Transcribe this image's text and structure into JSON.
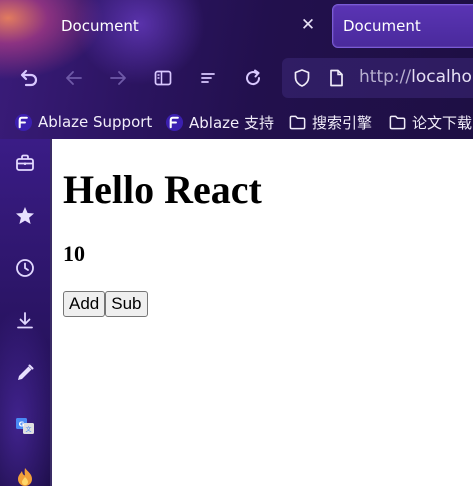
{
  "tabs": [
    {
      "title": "Document",
      "active": false
    },
    {
      "title": "Document",
      "active": true
    }
  ],
  "tab_close_glyph": "✕",
  "nav": {
    "buttons": [
      "undo-icon",
      "back-arrow-icon",
      "forward-arrow-icon",
      "reader-view-icon",
      "tab-list-icon",
      "reload-icon"
    ],
    "url_scheme": "http://",
    "url_host": "localho"
  },
  "bookmarks": [
    {
      "label": "Ablaze Support",
      "icon": "ablaze-logo-icon"
    },
    {
      "label": "Ablaze 支持",
      "icon": "ablaze-logo-icon"
    },
    {
      "label": "搜索引擎",
      "icon": "folder-icon"
    },
    {
      "label": "论文下载",
      "icon": "folder-icon"
    }
  ],
  "sidebar": [
    "toolbox-icon",
    "star-icon",
    "history-clock-icon",
    "download-icon",
    "pencil-icon",
    "translate-icon",
    "fire-icon"
  ],
  "page": {
    "heading": "Hello React",
    "count": "10",
    "add_label": "Add",
    "sub_label": "Sub"
  },
  "colors": {
    "chrome_bg": "#22104d",
    "active_tab": "#4a2a9c",
    "accent": "#7a5ad8",
    "page_bg": "#ffffff"
  }
}
